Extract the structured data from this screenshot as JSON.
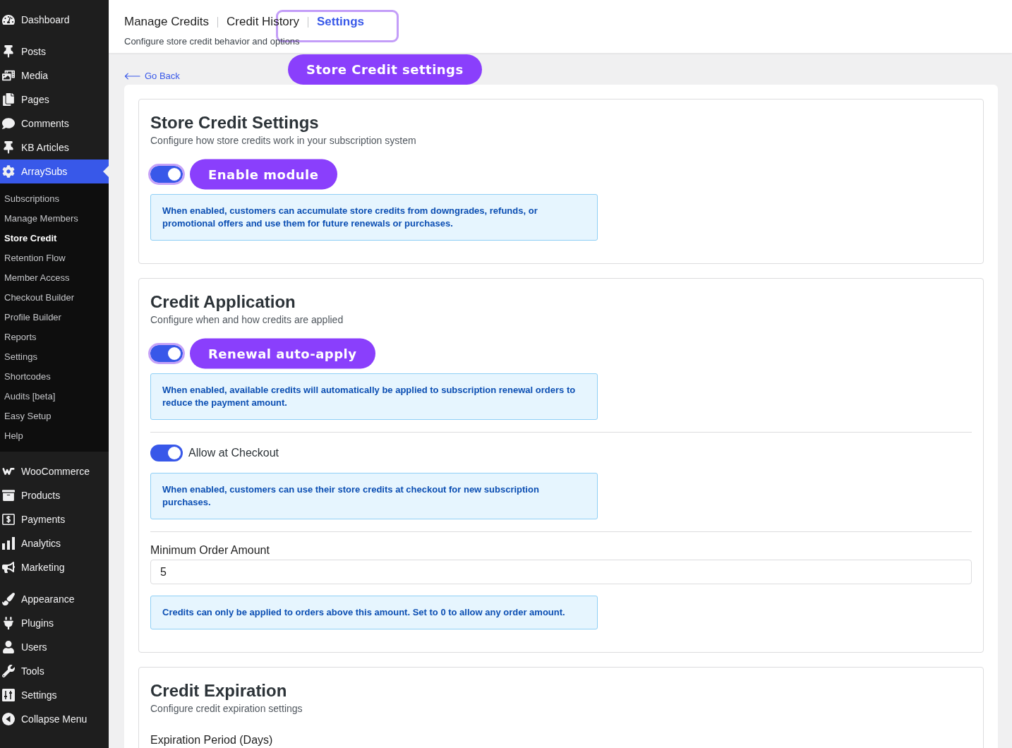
{
  "sidebar": {
    "groups": [
      {
        "items": [
          {
            "label": "Dashboard",
            "selected": false
          }
        ]
      },
      {
        "items": [
          {
            "label": "Posts",
            "selected": false
          },
          {
            "label": "Media",
            "selected": false
          },
          {
            "label": "Pages",
            "selected": false
          },
          {
            "label": "Comments",
            "selected": false
          },
          {
            "label": "KB Articles",
            "selected": false
          },
          {
            "label": "ArraySubs",
            "selected": true,
            "children": [
              {
                "label": "Subscriptions",
                "selected": false
              },
              {
                "label": "Manage Members",
                "selected": false
              },
              {
                "label": "Store Credit",
                "selected": true
              },
              {
                "label": "Retention Flow",
                "selected": false
              },
              {
                "label": "Member Access",
                "selected": false
              },
              {
                "label": "Checkout Builder",
                "selected": false
              },
              {
                "label": "Profile Builder",
                "selected": false
              },
              {
                "label": "Reports",
                "selected": false
              },
              {
                "label": "Settings",
                "selected": false
              },
              {
                "label": "Shortcodes",
                "selected": false
              },
              {
                "label": "Audits [beta]",
                "selected": false
              },
              {
                "label": "Easy Setup",
                "selected": false
              },
              {
                "label": "Help",
                "selected": false
              }
            ]
          }
        ]
      },
      {
        "items": [
          {
            "label": "WooCommerce",
            "selected": false
          },
          {
            "label": "Products",
            "selected": false
          },
          {
            "label": "Payments",
            "selected": false
          },
          {
            "label": "Analytics",
            "selected": false
          },
          {
            "label": "Marketing",
            "selected": false
          }
        ]
      },
      {
        "items": [
          {
            "label": "Appearance",
            "selected": false
          },
          {
            "label": "Plugins",
            "selected": false
          },
          {
            "label": "Users",
            "selected": false
          },
          {
            "label": "Tools",
            "selected": false
          },
          {
            "label": "Settings",
            "selected": false
          },
          {
            "label": "Collapse Menu",
            "selected": false
          }
        ]
      }
    ]
  },
  "header": {
    "tabs": [
      {
        "label": "Manage Credits",
        "selected": false,
        "framed": false
      },
      {
        "label": "Credit History",
        "selected": false,
        "framed": false
      },
      {
        "label": "Settings",
        "selected": true,
        "framed": true
      }
    ],
    "subtitle": "Configure store credit behavior and options"
  },
  "content": {
    "back_link": "Go Back",
    "callout": "Store Credit settings",
    "sections": [
      {
        "title": "Store Credit Settings",
        "description": "Configure how store credits work in your subscription system",
        "fields": [
          {
            "kind": "toggle",
            "on": true,
            "callout": "Enable module",
            "note": "When enabled, customers can accumulate store credits from downgrades, refunds, or promotional offers and use them for future renewals or purchases."
          }
        ]
      },
      {
        "title": "Credit Application",
        "description": "Configure when and how credits are applied",
        "fields": [
          {
            "kind": "toggle",
            "on": true,
            "callout": "Renewal auto-apply",
            "note": "When enabled, available credits will automatically be applied to subscription renewal orders to reduce the payment amount."
          },
          {
            "kind": "toggle",
            "on": true,
            "label": "Allow at Checkout",
            "note": "When enabled, customers can use their store credits at checkout for new subscription purchases."
          },
          {
            "kind": "number",
            "label": "Minimum Order Amount",
            "value": "5",
            "note": "Credits can only be applied to orders above this amount. Set to 0 to allow any order amount."
          }
        ]
      },
      {
        "title": "Credit Expiration",
        "description": "Configure credit expiration settings",
        "fields": [
          {
            "kind": "number",
            "label": "Expiration Period (Days)"
          }
        ]
      }
    ]
  }
}
